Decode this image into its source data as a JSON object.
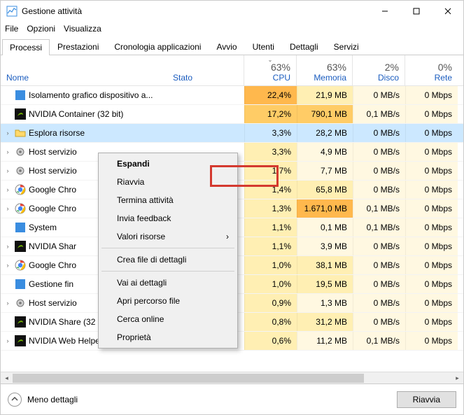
{
  "window": {
    "title": "Gestione attività"
  },
  "menubar": {
    "file": "File",
    "options": "Opzioni",
    "view": "Visualizza"
  },
  "tabs": {
    "processes": "Processi",
    "performance": "Prestazioni",
    "apphistory": "Cronologia applicazioni",
    "startup": "Avvio",
    "users": "Utenti",
    "details": "Dettagli",
    "services": "Servizi"
  },
  "columns": {
    "name": "Nome",
    "state": "Stato",
    "cpu_pct": "63%",
    "cpu": "CPU",
    "mem_pct": "63%",
    "mem": "Memoria",
    "disk_pct": "2%",
    "disk": "Disco",
    "net_pct": "0%",
    "net": "Rete"
  },
  "rows": [
    {
      "name": "Isolamento grafico dispositivo a...",
      "icon": "blue-square",
      "expand": "",
      "cpu": "22,4%",
      "cpuHeat": 4,
      "mem": "21,9 MB",
      "memHeat": 1,
      "disk": "0 MB/s",
      "diskHeat": 0,
      "net": "0 Mbps",
      "netHeat": 0,
      "selected": false
    },
    {
      "name": "NVIDIA Container (32 bit)",
      "icon": "nvidia",
      "expand": "",
      "cpu": "17,2%",
      "cpuHeat": 3,
      "mem": "790,1 MB",
      "memHeat": 3,
      "disk": "0,1 MB/s",
      "diskHeat": 0,
      "net": "0 Mbps",
      "netHeat": 0,
      "selected": false
    },
    {
      "name": "Esplora risorse",
      "icon": "folder",
      "expand": "›",
      "cpu": "3,3%",
      "cpuHeat": 0,
      "mem": "28,2 MB",
      "memHeat": 1,
      "disk": "0 MB/s",
      "diskHeat": 0,
      "net": "0 Mbps",
      "netHeat": 0,
      "selected": true
    },
    {
      "name": "Host servizio",
      "icon": "gear",
      "expand": "›",
      "cpu": "3,3%",
      "cpuHeat": 1,
      "mem": "4,9 MB",
      "memHeat": 0,
      "disk": "0 MB/s",
      "diskHeat": 0,
      "net": "0 Mbps",
      "netHeat": 0,
      "selected": false
    },
    {
      "name": "Host servizio",
      "icon": "gear",
      "expand": "›",
      "cpu": "1,7%",
      "cpuHeat": 1,
      "mem": "7,7 MB",
      "memHeat": 0,
      "disk": "0 MB/s",
      "diskHeat": 0,
      "net": "0 Mbps",
      "netHeat": 0,
      "selected": false
    },
    {
      "name": "Google Chro",
      "icon": "chrome",
      "expand": "›",
      "cpu": "1,4%",
      "cpuHeat": 1,
      "mem": "65,8 MB",
      "memHeat": 1,
      "disk": "0 MB/s",
      "diskHeat": 0,
      "net": "0 Mbps",
      "netHeat": 0,
      "selected": false
    },
    {
      "name": "Google Chro",
      "icon": "chrome",
      "expand": "›",
      "cpu": "1,3%",
      "cpuHeat": 1,
      "mem": "1.671,0 MB",
      "memHeat": 4,
      "disk": "0,1 MB/s",
      "diskHeat": 0,
      "net": "0 Mbps",
      "netHeat": 0,
      "selected": false
    },
    {
      "name": "System",
      "icon": "blue-square",
      "expand": "",
      "cpu": "1,1%",
      "cpuHeat": 1,
      "mem": "0,1 MB",
      "memHeat": 0,
      "disk": "0,1 MB/s",
      "diskHeat": 0,
      "net": "0 Mbps",
      "netHeat": 0,
      "selected": false
    },
    {
      "name": "NVIDIA Shar",
      "icon": "nvidia",
      "expand": "›",
      "cpu": "1,1%",
      "cpuHeat": 1,
      "mem": "3,9 MB",
      "memHeat": 0,
      "disk": "0 MB/s",
      "diskHeat": 0,
      "net": "0 Mbps",
      "netHeat": 0,
      "selected": false
    },
    {
      "name": "Google Chro",
      "icon": "chrome",
      "expand": "›",
      "cpu": "1,0%",
      "cpuHeat": 1,
      "mem": "38,1 MB",
      "memHeat": 1,
      "disk": "0 MB/s",
      "diskHeat": 0,
      "net": "0 Mbps",
      "netHeat": 0,
      "selected": false
    },
    {
      "name": "Gestione fin",
      "icon": "blue-square",
      "expand": "",
      "cpu": "1,0%",
      "cpuHeat": 1,
      "mem": "19,5 MB",
      "memHeat": 1,
      "disk": "0 MB/s",
      "diskHeat": 0,
      "net": "0 Mbps",
      "netHeat": 0,
      "selected": false
    },
    {
      "name": "Host servizio",
      "icon": "gear",
      "expand": "›",
      "cpu": "0,9%",
      "cpuHeat": 1,
      "mem": "1,3 MB",
      "memHeat": 0,
      "disk": "0 MB/s",
      "diskHeat": 0,
      "net": "0 Mbps",
      "netHeat": 0,
      "selected": false
    },
    {
      "name": "NVIDIA Share (32 bit)",
      "icon": "nvidia",
      "expand": "",
      "cpu": "0,8%",
      "cpuHeat": 1,
      "mem": "31,2 MB",
      "memHeat": 1,
      "disk": "0 MB/s",
      "diskHeat": 0,
      "net": "0 Mbps",
      "netHeat": 0,
      "selected": false
    },
    {
      "name": "NVIDIA Web Helper Service (32 ...",
      "icon": "nvidia",
      "expand": "›",
      "cpu": "0,6%",
      "cpuHeat": 1,
      "mem": "11,2 MB",
      "memHeat": 0,
      "disk": "0,1 MB/s",
      "diskHeat": 0,
      "net": "0 Mbps",
      "netHeat": 0,
      "selected": false
    }
  ],
  "context_menu": {
    "expand": "Espandi",
    "restart": "Riavvia",
    "end": "Termina attività",
    "feedback": "Invia feedback",
    "values": "Valori risorse",
    "dump": "Crea file di dettagli",
    "details": "Vai ai dettagli",
    "openloc": "Apri percorso file",
    "search": "Cerca online",
    "props": "Proprietà"
  },
  "footer": {
    "fewer": "Meno dettagli",
    "action": "Riavvia"
  }
}
